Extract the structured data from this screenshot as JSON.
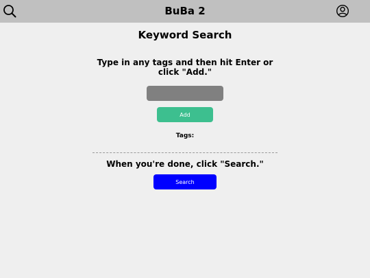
{
  "header": {
    "title": "BuBa 2",
    "background_color": "#c0c0c0",
    "left_icon": "search-icon",
    "right_icon": "account-circle-icon"
  },
  "main": {
    "heading": "Keyword Search",
    "instructions": "Type in any tags and then hit Enter or click \"Add.\"",
    "tag_input": {
      "value": "",
      "placeholder": ""
    },
    "add_button_label": "Add",
    "tags_label": "Tags:",
    "done_text": "When you're done, click \"Search.\"",
    "search_button_label": "Search"
  },
  "colors": {
    "background": "#efefef",
    "add_button": "#3dbf8f",
    "search_button": "#0000ff",
    "input_fill": "#808080"
  }
}
